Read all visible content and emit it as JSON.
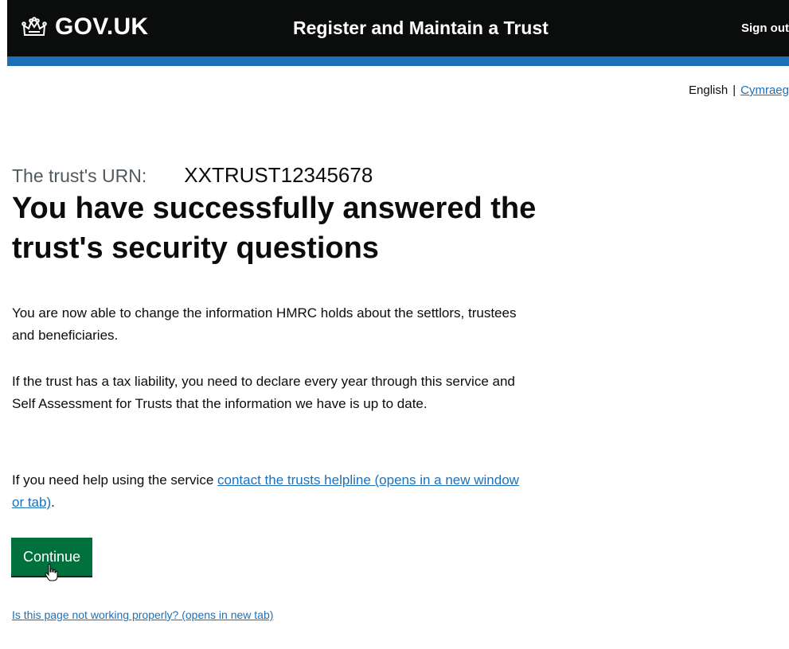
{
  "header": {
    "logo_text": "GOV.UK",
    "logo_icon": "crown-icon",
    "service_name": "Register and Maintain a Trust",
    "sign_out_label": "Sign out",
    "background": "#0b0c0c",
    "accent": "#1d70b8"
  },
  "language": {
    "current": "English",
    "separator": "|",
    "other": "Cymraeg"
  },
  "main": {
    "urn_label": "The trust's URN:",
    "urn_value": "XXTRUST12345678",
    "title": "You have successfully answered the trust's security questions",
    "paragraph_1": "You are now able to change the information HMRC holds about the settlors, trustees and beneficiaries.",
    "paragraph_2": "If the trust has a tax liability, you need to declare every year through this service and Self Assessment for Trusts that the information we have is up to date.",
    "paragraph_3_prefix": "If you need help using the service ",
    "helpline_link": "contact the trusts helpline (opens in a new window or tab)",
    "paragraph_3_suffix": ".",
    "continue_label": "Continue",
    "continue_color": "#00703c",
    "report_link": "Is this page not working properly? (opens in new tab)"
  }
}
